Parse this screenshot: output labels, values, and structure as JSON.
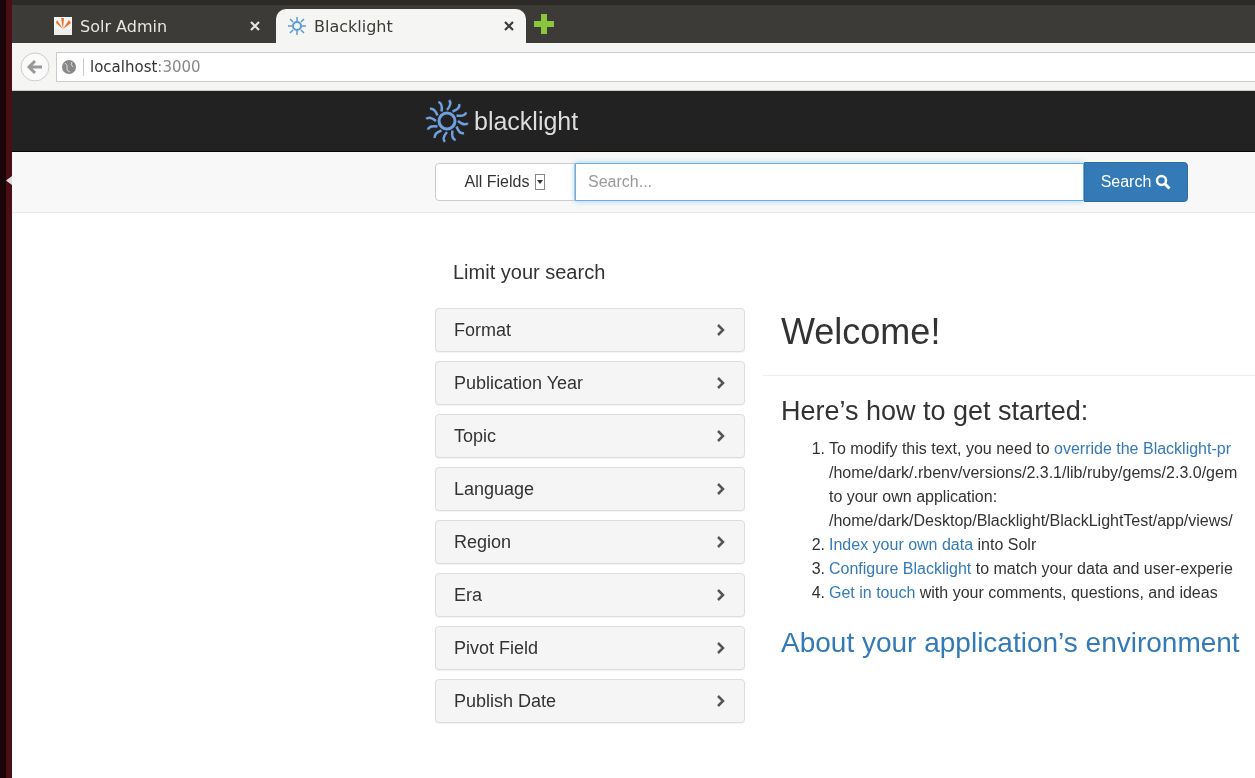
{
  "browser": {
    "tabs": [
      {
        "title": "Solr Admin",
        "kind": "solr",
        "selected": false
      },
      {
        "title": "Blacklight",
        "kind": "sun",
        "selected": true
      }
    ],
    "address": {
      "host": "localhost",
      "port": ":3000"
    }
  },
  "navbar": {
    "brand": "blacklight"
  },
  "search": {
    "field": "All Fields",
    "placeholder": "Search...",
    "button": "Search"
  },
  "sidebar": {
    "title": "Limit your search",
    "facets": [
      {
        "label": "Format",
        "expanded": false
      },
      {
        "label": "Publication Year",
        "expanded": false
      },
      {
        "label": "Topic",
        "expanded": false
      },
      {
        "label": "Language",
        "expanded": false
      },
      {
        "label": "Region",
        "expanded": false
      },
      {
        "label": "Era",
        "expanded": false
      },
      {
        "label": "Pivot Field",
        "expanded": false
      },
      {
        "label": "Publish Date",
        "expanded": false
      }
    ]
  },
  "main": {
    "title": "Welcome!",
    "subtitle": "Here’s how to get started:",
    "steps": [
      {
        "number": "1.",
        "lines": [
          [
            {
              "text": "To modify this text, you need to ",
              "kind": "text"
            },
            {
              "text": "override the Blacklight-pr",
              "kind": "link"
            }
          ],
          [
            {
              "text": "/home/dark/.rbenv/versions/2.3.1/lib/ruby/gems/2.3.0/gem",
              "kind": "text"
            }
          ],
          [
            {
              "text": "to your own application:",
              "kind": "text"
            }
          ],
          [
            {
              "text": "/home/dark/Desktop/Blacklight/BlackLightTest/app/views/",
              "kind": "text"
            }
          ]
        ]
      },
      {
        "number": "2.",
        "lines": [
          [
            {
              "text": "Index your own data",
              "kind": "link"
            },
            {
              "text": " into Solr",
              "kind": "text"
            }
          ]
        ]
      },
      {
        "number": "3.",
        "lines": [
          [
            {
              "text": "Configure Blacklight",
              "kind": "link"
            },
            {
              "text": " to match your data and user-experie",
              "kind": "text"
            }
          ]
        ]
      },
      {
        "number": "4.",
        "lines": [
          [
            {
              "text": "Get in touch",
              "kind": "link"
            },
            {
              "text": " with your comments, questions, and ideas",
              "kind": "text"
            }
          ]
        ]
      }
    ],
    "environment": "About your application’s environment"
  }
}
